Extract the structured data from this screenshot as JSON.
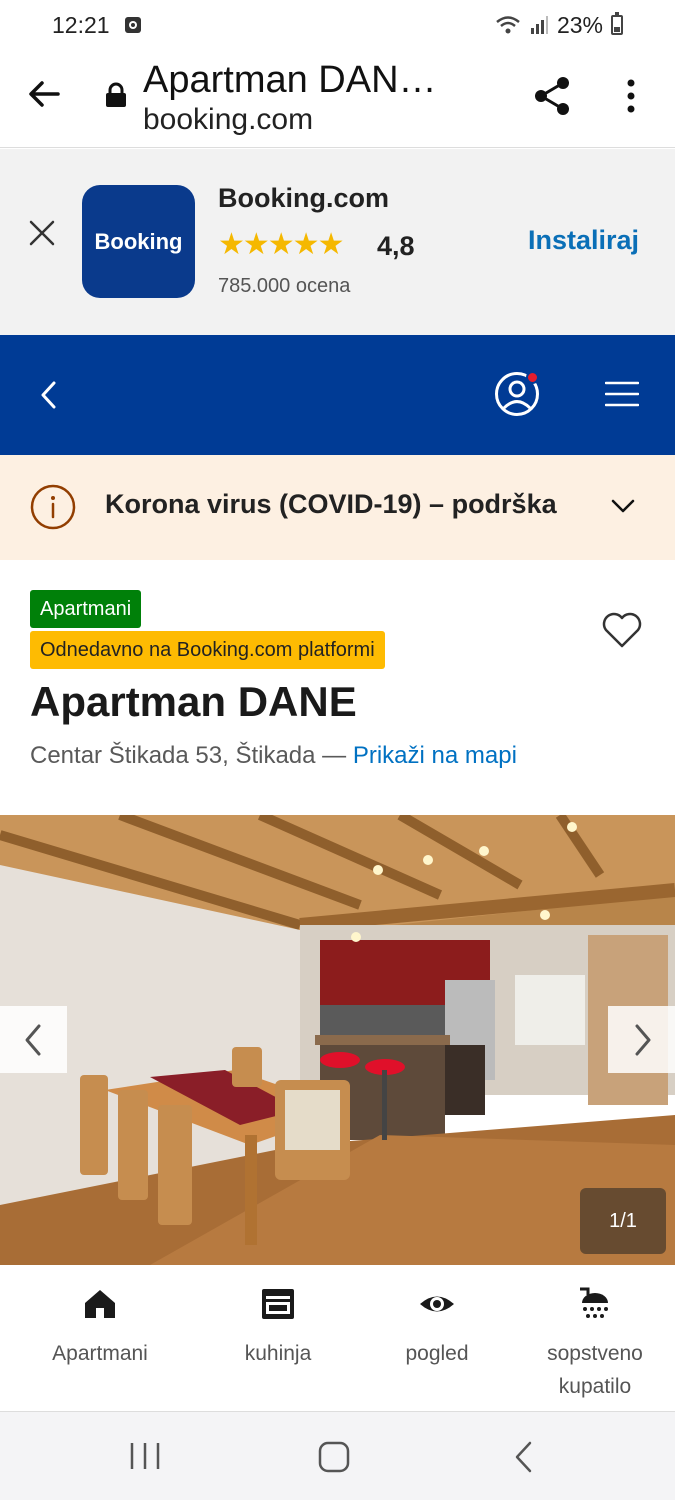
{
  "status_bar": {
    "time": "12:21",
    "battery": "23%"
  },
  "browser": {
    "page_title": "Apartman DAN…",
    "domain": "booking.com"
  },
  "app_banner": {
    "app_name": "Booking.com",
    "logo_text": "Booking",
    "stars": "★★★★★",
    "rating": "4,8",
    "reviews": "785.000 ocena",
    "install_label": "Instaliraj"
  },
  "covid_notice": {
    "text": "Korona virus (COVID-19) – podrška"
  },
  "property": {
    "type_badge": "Apartmani",
    "new_badge": "Odnedavno na Booking.com platformi",
    "name": "Apartman DANE",
    "address": "Centar Štikada 53, Štikada — ",
    "map_link": "Prikaži na mapi"
  },
  "gallery": {
    "counter": "1/1"
  },
  "facilities": [
    {
      "icon": "home-icon",
      "label": "Apartmani"
    },
    {
      "icon": "kitchen-icon",
      "label": "kuhinja"
    },
    {
      "icon": "eye-icon",
      "label": "pogled"
    },
    {
      "icon": "shower-icon",
      "label": "sopstveno kupatilo"
    }
  ],
  "colors": {
    "brand_blue": "#003b95",
    "link_blue": "#0071c2",
    "badge_green": "#008009",
    "badge_yellow": "#febb02",
    "covid_bg": "#fdf0e2"
  }
}
